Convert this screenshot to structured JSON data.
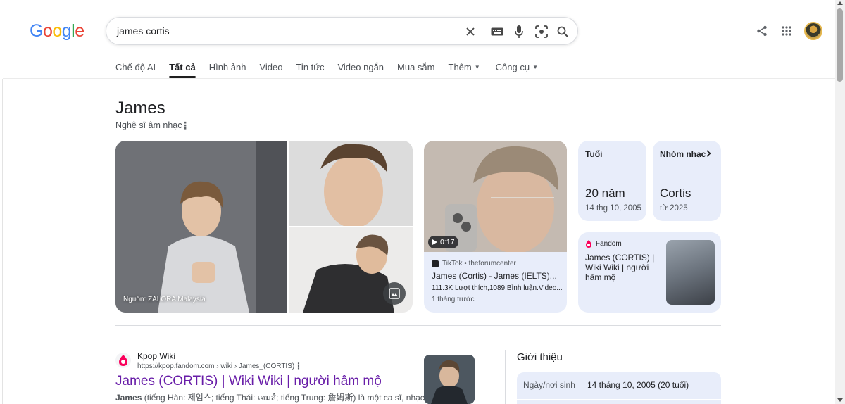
{
  "header": {
    "logo": "Google",
    "logo_colors": [
      "#4285F4",
      "#EA4335",
      "#FBBC05",
      "#4285F4",
      "#34A853",
      "#EA4335"
    ],
    "search_query": "james cortis",
    "search_icons": [
      "clear-icon",
      "keyboard-icon",
      "mic-icon",
      "lens-icon",
      "search-icon"
    ],
    "right_icons": [
      "share-icon",
      "apps-grid-icon",
      "profile-avatar"
    ]
  },
  "tabs": {
    "ai_mode": "Chế độ AI",
    "all": "Tất cả",
    "images": "Hình ảnh",
    "videos": "Video",
    "news": "Tin tức",
    "short_videos": "Video ngắn",
    "shopping": "Mua sắm",
    "more": "Thêm",
    "tools": "Công cụ",
    "active": "Tất cả"
  },
  "knowledge_panel": {
    "title": "James",
    "subtitle": "Nghệ sĩ âm nhạc",
    "image_source": "Nguồn: ZALORA Malaysia",
    "video": {
      "duration": "0:17",
      "source": "TikTok • theforumcenter",
      "title": "James (Cortis) - James (IELTS)...",
      "meta": "111.3K Lượt thích,1089 Bình luận.Video...",
      "time": "1 tháng trước"
    },
    "age_card": {
      "label": "Tuổi",
      "value": "20 năm",
      "detail": "14 thg 10, 2005"
    },
    "band_card": {
      "label": "Nhóm nhạc",
      "value": "Cortis",
      "detail": "từ 2025"
    },
    "fandom_card": {
      "source": "Fandom",
      "title": "James (CORTIS) | Wiki Wiki | người hâm mộ"
    }
  },
  "result": {
    "site_name": "Kpop Wiki",
    "url": "https://kpop.fandom.com › wiki › James_(CORTIS)",
    "title": "James (CORTIS) | Wiki Wiki | người hâm mộ",
    "snippet_bold": "James",
    "snippet_rest": " (tiếng Hàn: 제임스; tiếng Thái: เจมส์; tiếng Trung: 詹姆斯) là một ca sĩ, nhạc sĩ,"
  },
  "intro": {
    "heading": "Giới thiệu",
    "rows": [
      {
        "key": "Ngày/nơi sinh",
        "value": "14 tháng 10, 2005 (20 tuổi)"
      }
    ]
  },
  "colors": {
    "visited_link": "#681da8",
    "card_bg": "#e8edfa",
    "fandom_red": "#fa005a"
  }
}
